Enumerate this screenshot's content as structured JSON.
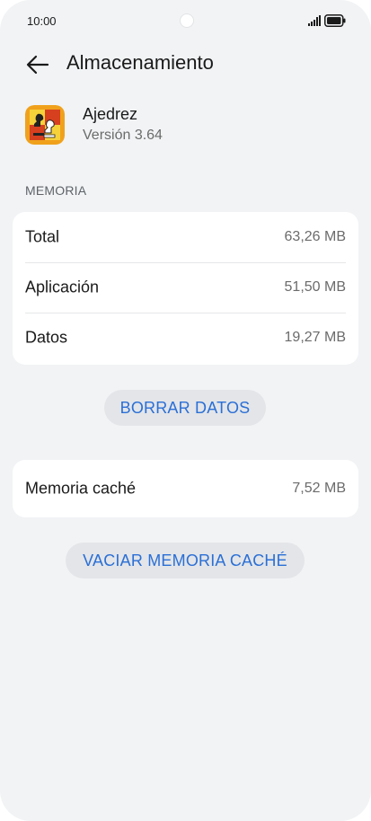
{
  "status_bar": {
    "time": "10:00"
  },
  "header": {
    "title": "Almacenamiento"
  },
  "app": {
    "name": "Ajedrez",
    "version": "Versión 3.64"
  },
  "memory_section": {
    "label": "MEMORIA",
    "rows": [
      {
        "label": "Total",
        "value": "63,26 MB"
      },
      {
        "label": "Aplicación",
        "value": "51,50 MB"
      },
      {
        "label": "Datos",
        "value": "19,27 MB"
      }
    ]
  },
  "clear_data_button": {
    "label": "BORRAR DATOS"
  },
  "cache": {
    "label": "Memoria caché",
    "value": "7,52 MB"
  },
  "clear_cache_button": {
    "label": "VACIAR MEMORIA CACHÉ"
  },
  "colors": {
    "background": "#f1f3f5",
    "card": "#ffffff",
    "accent": "#2b6fd6",
    "button_bg": "#e3e5e8"
  }
}
